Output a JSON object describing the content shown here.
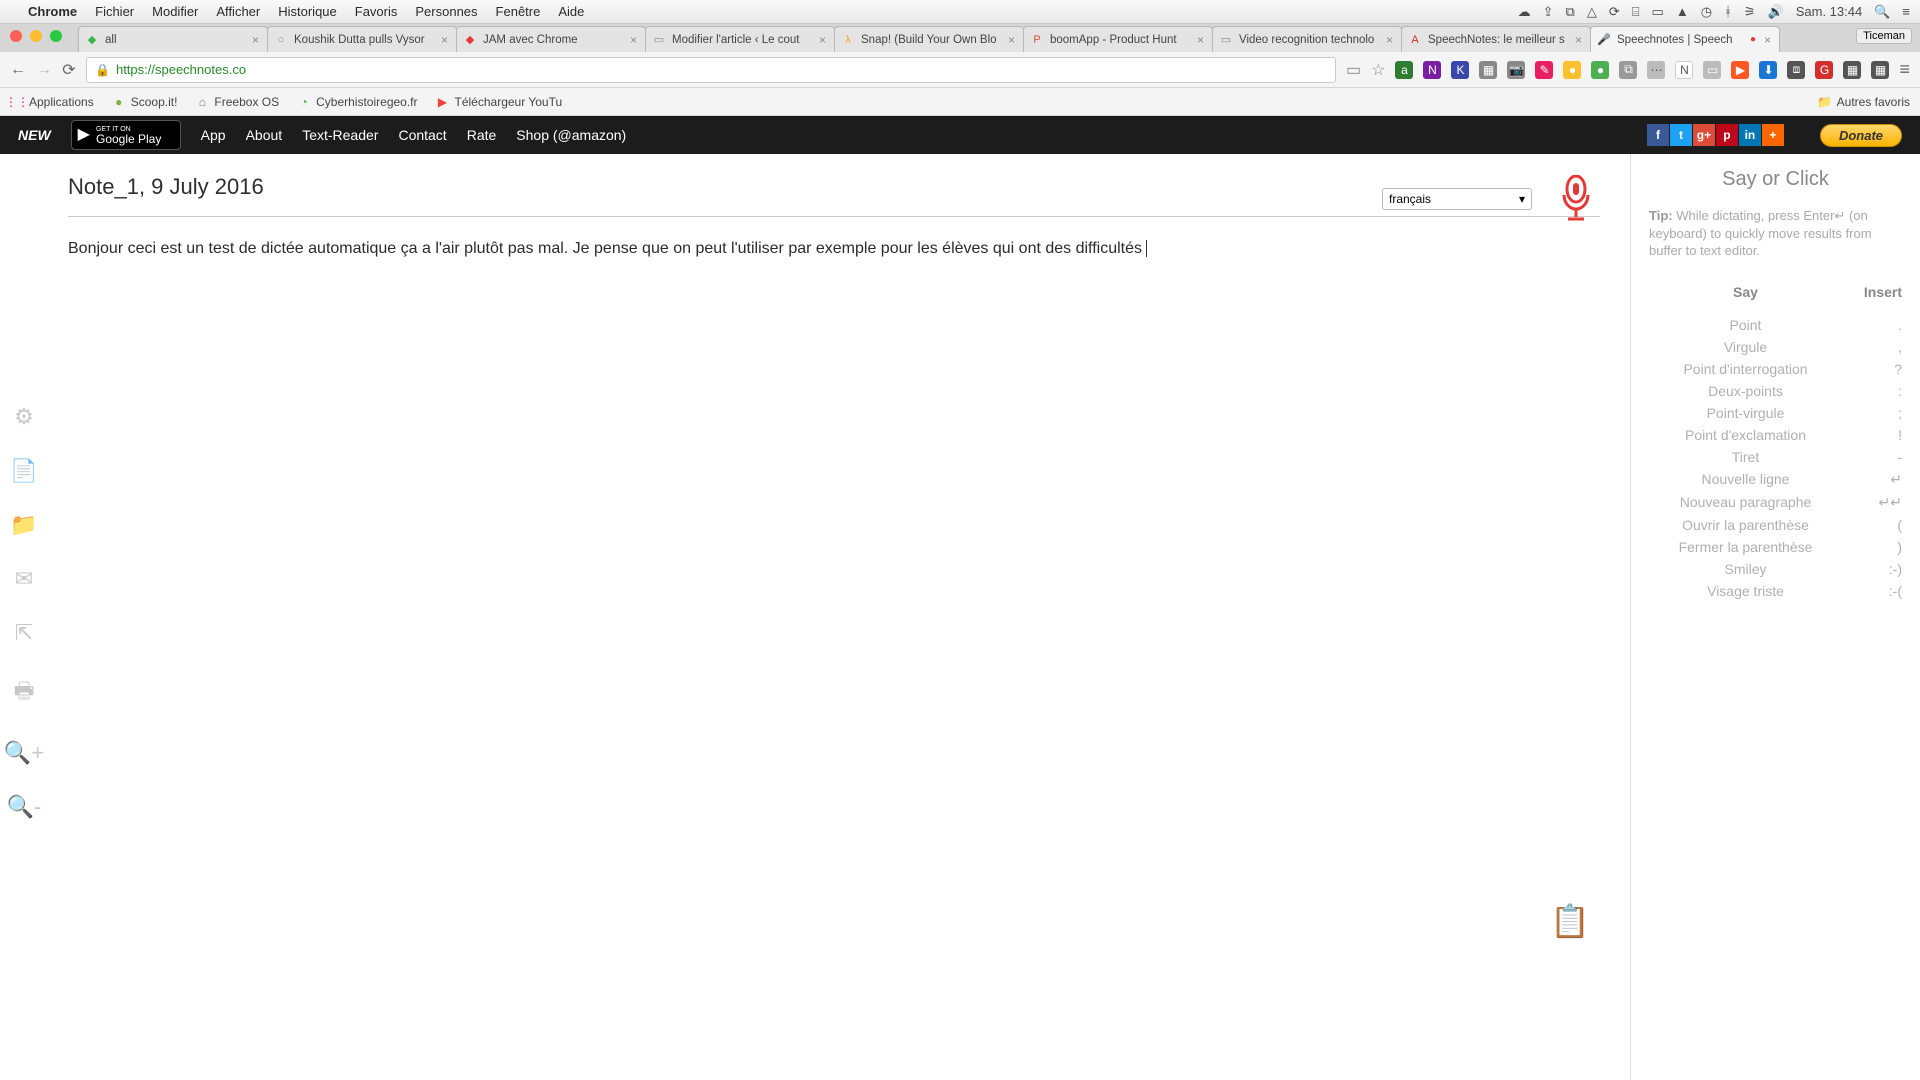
{
  "mac_menu": {
    "app": "Chrome",
    "items": [
      "Fichier",
      "Modifier",
      "Afficher",
      "Historique",
      "Favoris",
      "Personnes",
      "Fenêtre",
      "Aide"
    ],
    "clock": "Sam. 13:44"
  },
  "browser": {
    "user_badge": "Ticeman",
    "tabs": [
      {
        "label": "all",
        "favicon_color": "#3cb54a",
        "favicon_text": "◆"
      },
      {
        "label": "Koushik Dutta pulls Vysor",
        "favicon_color": "#888",
        "favicon_text": "○"
      },
      {
        "label": "JAM avec Chrome",
        "favicon_color": "#e53935",
        "favicon_text": "◆"
      },
      {
        "label": "Modifier l'article ‹ Le cout",
        "favicon_color": "#888",
        "favicon_text": "▭"
      },
      {
        "label": "Snap! (Build Your Own Blo",
        "favicon_color": "#f5a623",
        "favicon_text": "λ"
      },
      {
        "label": "boomApp - Product Hunt",
        "favicon_color": "#da552f",
        "favicon_text": "P"
      },
      {
        "label": "Video recognition technolo",
        "favicon_color": "#888",
        "favicon_text": "▭"
      },
      {
        "label": "SpeechNotes: le meilleur s",
        "favicon_color": "#d32f2f",
        "favicon_text": "A"
      },
      {
        "label": "Speechnotes | Speech",
        "favicon_color": "#d84315",
        "favicon_text": "🎤",
        "active": true,
        "recording": true
      }
    ],
    "url": "https://speechnotes.co",
    "bookmarks": [
      {
        "label": "Applications",
        "icon": "⋮⋮",
        "color": "#f06"
      },
      {
        "label": "Scoop.it!",
        "icon": "●",
        "color": "#7cb342"
      },
      {
        "label": "Freebox OS",
        "icon": "⌂",
        "color": "#777"
      },
      {
        "label": "Cyberhistoiregeo.fr",
        "icon": "◔",
        "color": "#4caf50"
      },
      {
        "label": "Téléchargeur YouTu",
        "icon": "▶",
        "color": "#f44336"
      }
    ],
    "other_bookmarks": "Autres favoris"
  },
  "sn_nav": {
    "new": "NEW",
    "gplay_top": "GET IT ON",
    "gplay_bottom": "Google Play",
    "links": [
      "App",
      "About",
      "Text-Reader",
      "Contact",
      "Rate",
      "Shop (@amazon)"
    ],
    "donate": "Donate"
  },
  "editor": {
    "title": "Note_1, 9 July 2016",
    "language": "français",
    "text": "Bonjour ceci est un test de dictée automatique ça a l'air plutôt pas mal. Je pense que on peut l'utiliser par exemple pour les élèves qui ont des difficultés"
  },
  "right_panel": {
    "title": "Say or Click",
    "tip_label": "Tip:",
    "tip_text": " While dictating, press Enter↵ (on keyboard) to quickly move results from buffer to text editor.",
    "head_say": "Say",
    "head_insert": "Insert",
    "rows": [
      {
        "say": "Point",
        "ins": "."
      },
      {
        "say": "Virgule",
        "ins": ","
      },
      {
        "say": "Point d'interrogation",
        "ins": "?"
      },
      {
        "say": "Deux-points",
        "ins": ":"
      },
      {
        "say": "Point-virgule",
        "ins": ";"
      },
      {
        "say": "Point d'exclamation",
        "ins": "!"
      },
      {
        "say": "Tiret",
        "ins": "-"
      },
      {
        "say": "Nouvelle ligne",
        "ins": "↵"
      },
      {
        "say": "Nouveau paragraphe",
        "ins": "↵↵"
      },
      {
        "say": "Ouvrir la parenthèse",
        "ins": "("
      },
      {
        "say": "Fermer la parenthèse",
        "ins": ")"
      },
      {
        "say": "Smiley",
        "ins": ":-)"
      },
      {
        "say": "Visage triste",
        "ins": ":-("
      }
    ]
  }
}
